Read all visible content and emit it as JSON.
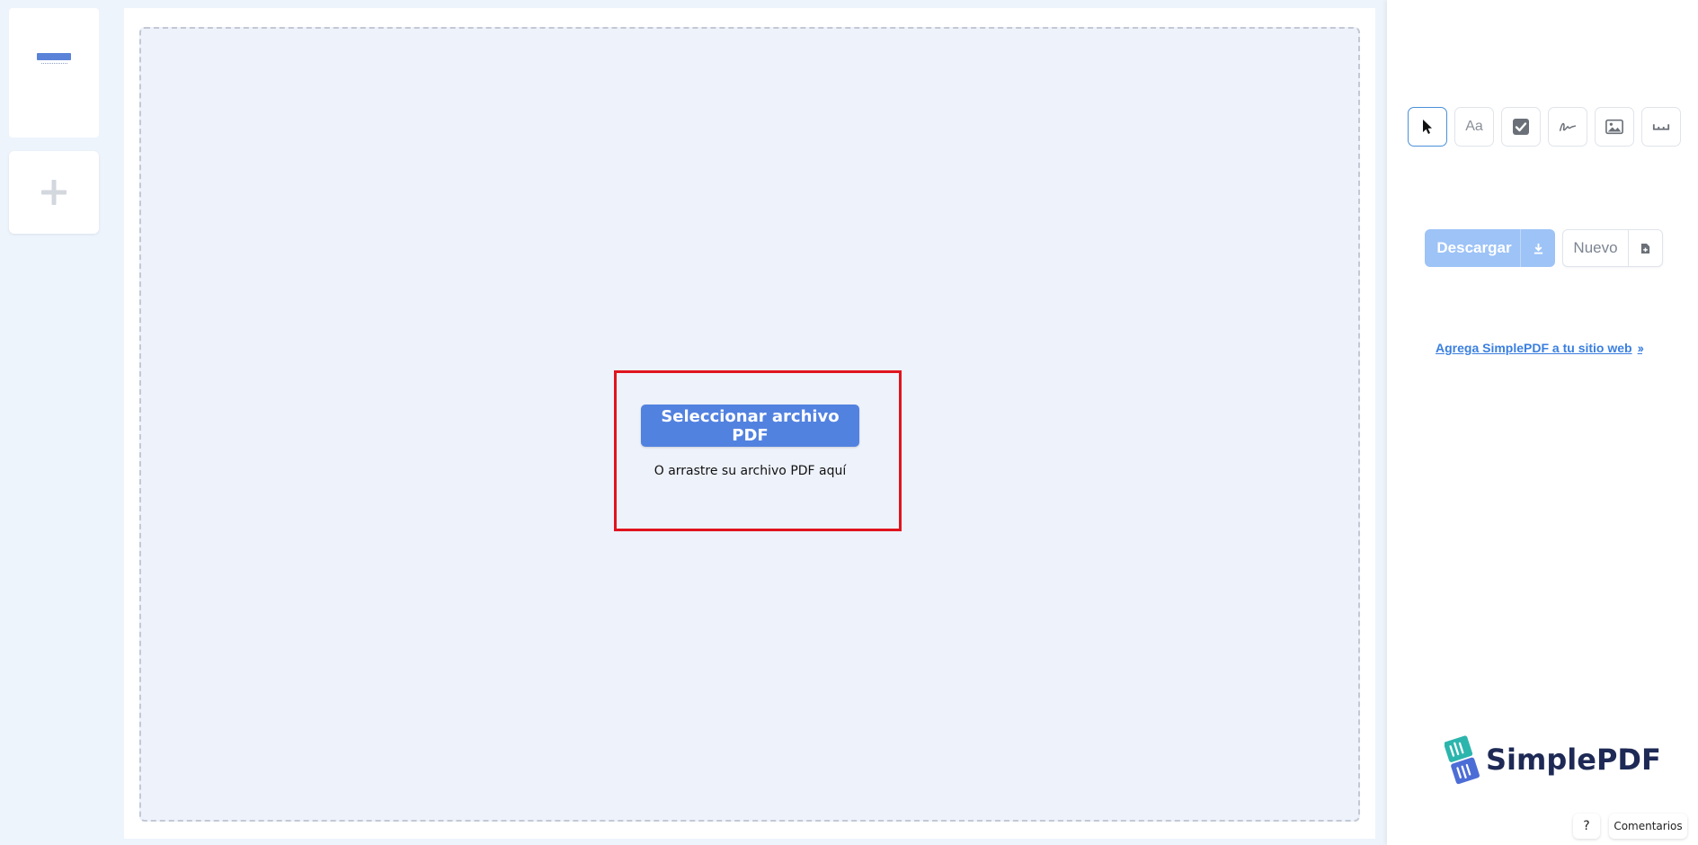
{
  "main": {
    "select_button_label": "Seleccionar archivo PDF",
    "drag_hint": "O arrastre su archivo PDF aquí"
  },
  "toolbar": {
    "tools": [
      {
        "name": "select",
        "icon": "cursor-icon",
        "label": ""
      },
      {
        "name": "text",
        "icon": "text-icon",
        "label": "Aa"
      },
      {
        "name": "checkbox",
        "icon": "checkbox-icon",
        "label": ""
      },
      {
        "name": "signature",
        "icon": "signature-icon",
        "label": ""
      },
      {
        "name": "image",
        "icon": "image-icon",
        "label": ""
      },
      {
        "name": "space",
        "icon": "space-icon",
        "label": ""
      }
    ],
    "active": "select"
  },
  "actions": {
    "download_label": "Descargar",
    "new_label": "Nuevo"
  },
  "embed_link": {
    "label": "Agrega SimplePDF a tu sitio web",
    "chevron": "››"
  },
  "brand": {
    "name": "SimplePDF"
  },
  "footer": {
    "help_label": "?",
    "feedback_label": "Comentarios"
  },
  "colors": {
    "primary": "#5282e0",
    "primary_disabled": "#9dc3f7",
    "highlight_border": "#e0141e",
    "link": "#3a7fe0",
    "brand_text": "#1e2a55",
    "background": "#eef4fc"
  }
}
